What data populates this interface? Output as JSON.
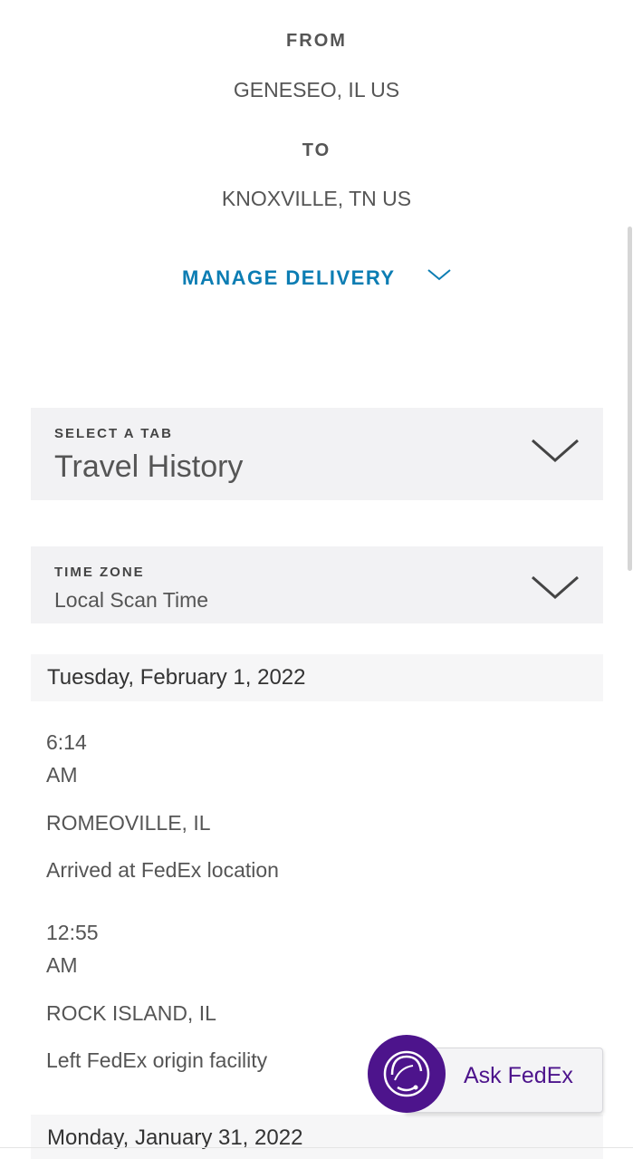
{
  "shipment": {
    "from_label": "FROM",
    "from_value": "GENESEO, IL US",
    "to_label": "TO",
    "to_value": "KNOXVILLE, TN US"
  },
  "manage_delivery": {
    "label": "MANAGE DELIVERY",
    "icon": "chevron-down-icon"
  },
  "tab_select": {
    "label": "SELECT A TAB",
    "value": "Travel History",
    "icon": "chevron-down-icon"
  },
  "timezone_select": {
    "label": "TIME ZONE",
    "value": "Local Scan Time",
    "icon": "chevron-down-icon"
  },
  "travel_history": [
    {
      "date": "Tuesday, February 1, 2022",
      "events": [
        {
          "time": "6:14",
          "ampm": "AM",
          "location": "ROMEOVILLE, IL",
          "status": "Arrived at FedEx location"
        },
        {
          "time": "12:55",
          "ampm": "AM",
          "location": "ROCK ISLAND, IL",
          "status": "Left FedEx origin facility"
        }
      ]
    },
    {
      "date": "Monday, January 31, 2022",
      "events": []
    }
  ],
  "ask_fedex": {
    "label": "Ask FedEx",
    "icon": "headset-agent-icon"
  },
  "colors": {
    "accent_blue": "#0c7db3",
    "fedex_purple": "#4d148c",
    "panel_gray": "#f2f2f4"
  }
}
